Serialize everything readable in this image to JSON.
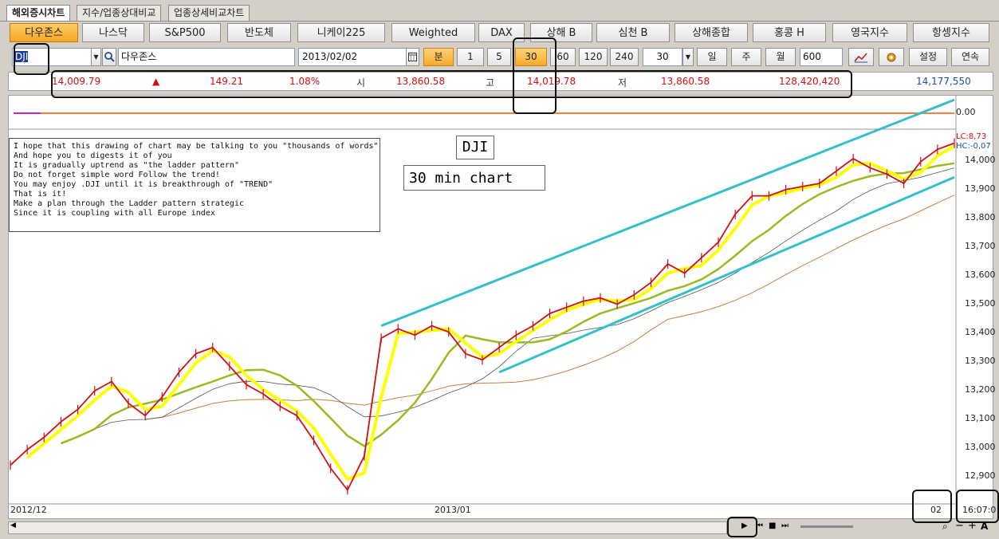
{
  "tabs": [
    "해외증시차트",
    "지수/업종상대비교",
    "업종상세비교차트"
  ],
  "markets": [
    "다우존스",
    "나스닥",
    "S&P500",
    "반도체",
    "니케이225",
    "Weighted",
    "DAX",
    "상해 B",
    "심천 B",
    "상해종합",
    "홍콩 H",
    "영국지수",
    "항셍지수"
  ],
  "selected_market": "다우존스",
  "toolbar": {
    "symbol": "DJI",
    "symbol_name": "다우존스",
    "date": "2013/02/02",
    "unit_label": "분",
    "periods": [
      "1",
      "5",
      "30",
      "60",
      "120",
      "240"
    ],
    "selected_period": "30",
    "period_value": "30",
    "day_label": "일",
    "week_label": "주",
    "month_label": "월",
    "count": "600",
    "settings_label": "설정",
    "continuous_label": "연속"
  },
  "quote": {
    "price": "14,009.79",
    "arrow": "▲",
    "change": "149.21",
    "pct": "1.08%",
    "open_label": "시",
    "open": "13,860.58",
    "high_label": "고",
    "high": "14,019.78",
    "low_label": "저",
    "low": "13,860.58",
    "volume": "128,420,420",
    "extra": "14,177,550"
  },
  "indicator": {
    "zero": "0.00"
  },
  "note_lines": [
    "I hope that this drawing of chart may be talking to you \"thousands of words\"",
    "And hope you to digests it of you",
    "It is gradually uptrend as \"the ladder pattern\"",
    "Do not forget simple word Follow the trend!",
    "You may enjoy .DJI until it is breakthrough of \"TREND\"",
    "That is it!",
    "Make a plan through the Ladder pattern strategic",
    "Since it is coupling with all Europe index"
  ],
  "chart_title": "DJI",
  "chart_subtitle": "30 min chart",
  "legend": {
    "lc": "LC:8,73",
    "hc": "HC:-0,07"
  },
  "y_ticks": [
    "14,000",
    "13,900",
    "13,800",
    "13,700",
    "13,600",
    "13,500",
    "13,400",
    "13,300",
    "13,200",
    "13,100",
    "13,000",
    "12,900"
  ],
  "x_labels": {
    "start": "2012/12",
    "mid": "2013/01",
    "day": "02",
    "time": "16:07:0"
  },
  "colors": {
    "up": "#d01010",
    "accent": "#f5a623",
    "ma_fast": "#ffff00",
    "ma_mid": "#99bb22",
    "ma_slow": "#c8803c",
    "trend": "#33c0c8"
  },
  "chart_data": {
    "type": "line",
    "title": "DJI",
    "subtitle": "30 min chart",
    "ylim": [
      12850,
      14050
    ],
    "x_markers": [
      "2012/12",
      "2013/01",
      "02"
    ],
    "series": [
      {
        "name": "",
        "values": [
          12970,
          13020,
          13060,
          13110,
          13150,
          13210,
          13240,
          13170,
          13130,
          13190,
          13270,
          13330,
          13350,
          13290,
          13230,
          13200,
          13160,
          13130,
          13050,
          12960,
          12890,
          13000,
          13380,
          13410,
          13390,
          13420,
          13400,
          13330,
          13310,
          13350,
          13390,
          13420,
          13460,
          13480,
          13500,
          13510,
          13490,
          13520,
          13560,
          13620,
          13590,
          13640,
          13690,
          13780,
          13840,
          13840,
          13860,
          13870,
          13880,
          13920,
          13960,
          13930,
          13910,
          13880,
          13950,
          13990,
          14010
        ]
      }
    ]
  }
}
